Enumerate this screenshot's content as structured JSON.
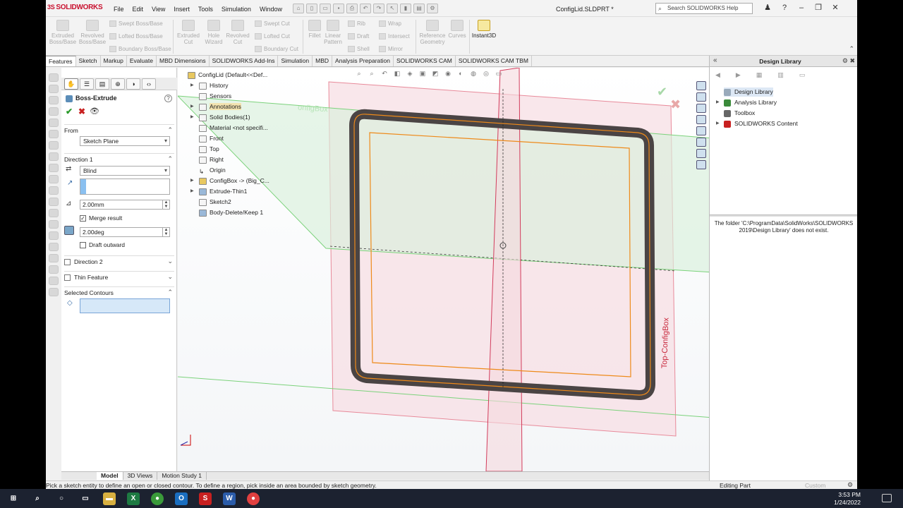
{
  "app": {
    "logo_ds": "3S",
    "logo_text": "SOLIDWORKS",
    "document_title": "ConfigLid.SLDPRT *",
    "help_placeholder": "Search SOLIDWORKS Help",
    "menu": [
      "File",
      "Edit",
      "View",
      "Insert",
      "Tools",
      "Simulation",
      "Window"
    ]
  },
  "ribbon": {
    "extruded_boss": "Extruded Boss/Base",
    "revolved_boss": "Revolved Boss/Base",
    "swept_boss": "Swept Boss/Base",
    "lofted_boss": "Lofted Boss/Base",
    "boundary_boss": "Boundary Boss/Base",
    "extruded_cut": "Extruded Cut",
    "hole_wizard": "Hole Wizard",
    "revolved_cut": "Revolved Cut",
    "swept_cut": "Swept Cut",
    "lofted_cut": "Lofted Cut",
    "boundary_cut": "Boundary Cut",
    "fillet": "Fillet",
    "linear_pattern": "Linear Pattern",
    "rib": "Rib",
    "draft": "Draft",
    "shell": "Shell",
    "wrap": "Wrap",
    "intersect": "Intersect",
    "mirror": "Mirror",
    "reference_geometry": "Reference Geometry",
    "curves": "Curves",
    "instant3d": "Instant3D"
  },
  "command_tabs": [
    "Features",
    "Sketch",
    "Markup",
    "Evaluate",
    "MBD Dimensions",
    "SOLIDWORKS Add-Ins",
    "Simulation",
    "MBD",
    "Analysis Preparation",
    "SOLIDWORKS CAM",
    "SOLIDWORKS CAM TBM"
  ],
  "property_manager": {
    "title": "Boss-Extrude",
    "help": "?",
    "from_label": "From",
    "from_value": "Sketch Plane",
    "direction1_label": "Direction 1",
    "end_condition": "Blind",
    "depth": "2.00mm",
    "merge_result": "Merge result",
    "draft_angle": "2.00deg",
    "draft_outward": "Draft outward",
    "direction2_label": "Direction 2",
    "thin_feature_label": "Thin Feature",
    "selected_contours_label": "Selected Contours"
  },
  "feature_tree": {
    "root": "ConfigLid  (Default<<Def...",
    "items": [
      {
        "label": "History",
        "expand": "▶"
      },
      {
        "label": "Sensors",
        "expand": ""
      },
      {
        "label": "Annotations",
        "expand": "▶"
      },
      {
        "label": "Solid Bodies(1)",
        "expand": "▶"
      },
      {
        "label": "Material <not specifi...",
        "expand": ""
      },
      {
        "label": "Front",
        "expand": ""
      },
      {
        "label": "Top",
        "expand": ""
      },
      {
        "label": "Right",
        "expand": ""
      },
      {
        "label": "Origin",
        "expand": ""
      },
      {
        "label": "ConfigBox -> (Big_C...",
        "expand": "▶"
      },
      {
        "label": "Extrude-Thin1",
        "expand": "▶"
      },
      {
        "label": "Sketch2",
        "expand": ""
      },
      {
        "label": "Body-Delete/Keep 1",
        "expand": ""
      }
    ]
  },
  "viewport": {
    "plane_label_top": "Top-ConfigBox",
    "plane_label_ghost": "onfigBox",
    "colors": {
      "green_plane": "#d9f0dc",
      "pink_plane": "#f7dfe4",
      "part_frame": "#4a4444",
      "sketch_orange": "#ee8a1a"
    }
  },
  "bottom_tabs": [
    "Model",
    "3D Views",
    "Motion Study 1"
  ],
  "status": {
    "message": "Pick a sketch entity to define an open or closed contour. To define a region, pick inside an area bounded by sketch geometry.",
    "mode": "Editing Part",
    "units": "Custom"
  },
  "design_library": {
    "title": "Design Library",
    "items": [
      {
        "label": "Design Library",
        "expand": "",
        "color": "#9ab"
      },
      {
        "label": "Analysis Library",
        "expand": "▶",
        "color": "#3a8a3a"
      },
      {
        "label": "Toolbox",
        "expand": "",
        "color": "#666"
      },
      {
        "label": "SOLIDWORKS Content",
        "expand": "▶",
        "color": "#c82020"
      }
    ],
    "message": "The folder 'C:\\ProgramData\\SolidWorks\\SOLIDWORKS 2019\\Design Library' does not exist."
  },
  "taskbar": {
    "time": "3:53 PM",
    "date": "1/24/2022"
  }
}
